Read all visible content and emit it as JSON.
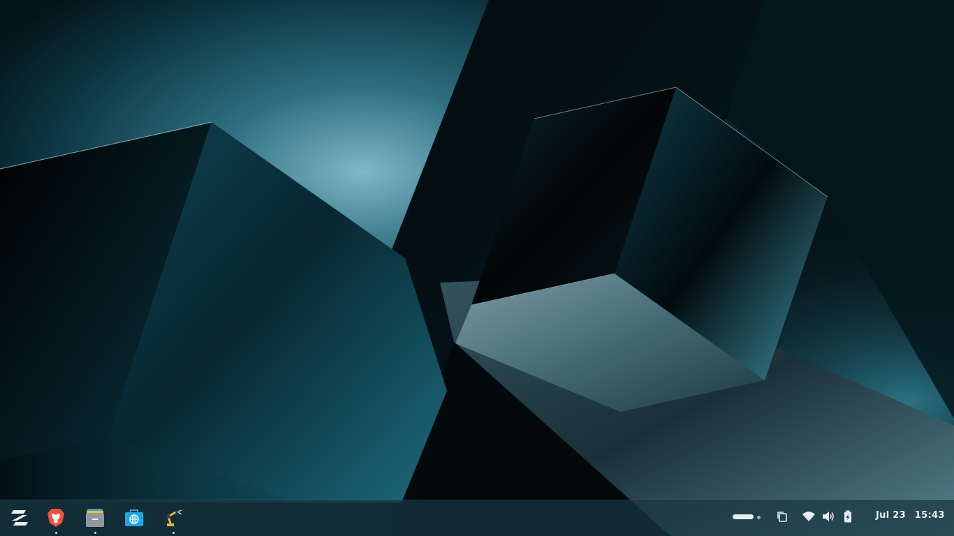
{
  "desktop": {
    "wallpaper": "abstract-cubes",
    "colors": {
      "base": "#061a22",
      "teal_light": "#7fb8c6",
      "teal": "#0f4f5f",
      "black": "#020708"
    }
  },
  "taskbar": {
    "apps": [
      {
        "id": "zorin-menu",
        "icon": "zorin-logo-icon",
        "running": false
      },
      {
        "id": "brave",
        "icon": "brave-browser-icon",
        "running": true
      },
      {
        "id": "files",
        "icon": "file-manager-icon",
        "running": true
      },
      {
        "id": "software",
        "icon": "software-store-icon",
        "running": false
      },
      {
        "id": "tool",
        "icon": "robot-arm-icon",
        "running": true
      }
    ],
    "tray": {
      "workspace_indicator": "workspace-indicator-icon",
      "window_switcher": "window-overview-icon",
      "wifi": "wifi-icon",
      "volume": "volume-icon",
      "battery": "battery-charging-icon"
    },
    "clock": {
      "date": "Jul 23",
      "time": "15:43"
    }
  }
}
